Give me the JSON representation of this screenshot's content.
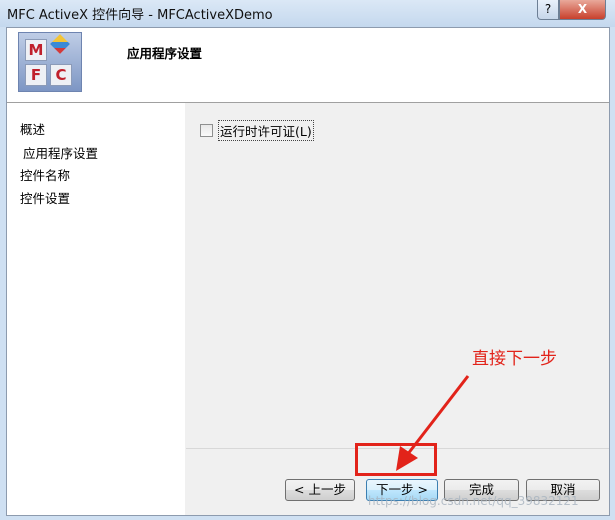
{
  "window": {
    "title": "MFC ActiveX 控件向导 - MFCActiveXDemo",
    "help_label": "?",
    "close_label": "X"
  },
  "header": {
    "logo_letters": [
      "M",
      "F",
      "C"
    ],
    "page_title": "应用程序设置"
  },
  "sidebar": {
    "items": [
      {
        "label": "概述"
      },
      {
        "label": "应用程序设置",
        "selected": true
      },
      {
        "label": "控件名称"
      },
      {
        "label": "控件设置"
      }
    ]
  },
  "options": {
    "runtime_license_label": "运行时许可证(L)",
    "runtime_license_checked": false
  },
  "buttons": {
    "prev": "< 上一步",
    "next": "下一步 >",
    "finish": "完成",
    "cancel": "取消"
  },
  "annotation": {
    "text": "直接下一步",
    "color": "#e2231a"
  },
  "watermark": {
    "text": "https://blog.csdn.net/qq_39832121"
  }
}
